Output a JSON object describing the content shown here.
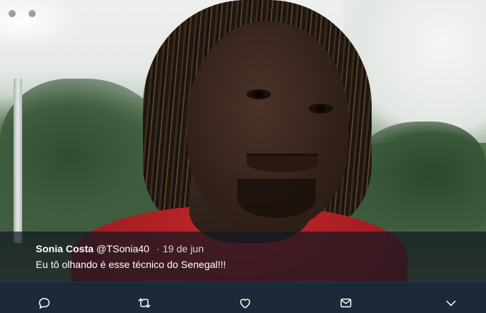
{
  "tweet": {
    "author_name": "Sonia Costa",
    "author_handle": "@TSonia40",
    "separator": "·",
    "date": "19 de jun",
    "text": "Eu tô olhando é esse técnico do Senegal!!!"
  },
  "actions": [
    {
      "icon": "reply-icon"
    },
    {
      "icon": "retweet-icon"
    },
    {
      "icon": "like-icon"
    },
    {
      "icon": "direct-message-icon"
    },
    {
      "icon": "more-chevron-icon"
    }
  ],
  "colors": {
    "background": "#1c2938",
    "caption_overlay": "#121821",
    "text": "#ffffff"
  }
}
